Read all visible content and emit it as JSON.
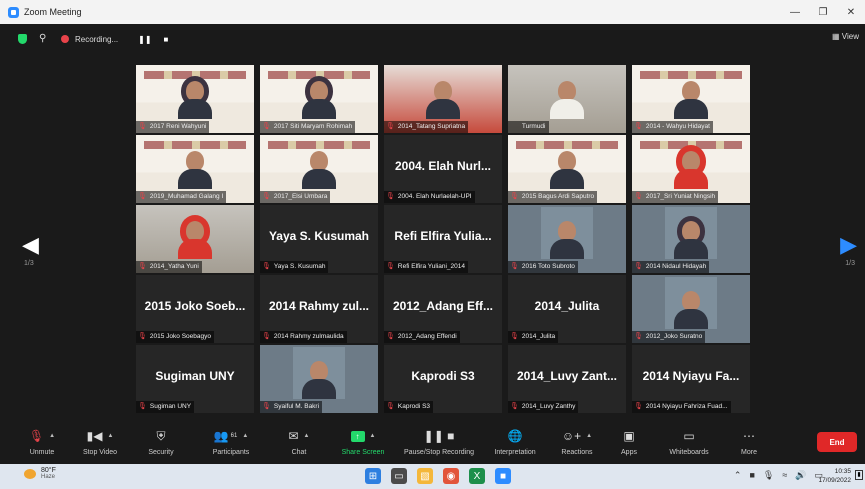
{
  "window": {
    "title": "Zoom Meeting"
  },
  "meeting_bar": {
    "recording_label": "Recording...",
    "view_label": "View"
  },
  "pages": {
    "left": "1/3",
    "right": "1/3"
  },
  "tiles": [
    {
      "name": "2017 Reni Wahyuni",
      "video": true,
      "bg": "slide",
      "person": "hijab"
    },
    {
      "name": "2017 Siti Maryam Rohimah",
      "video": true,
      "bg": "slide",
      "person": "hijab"
    },
    {
      "name": "2014_Tatang Supriatna",
      "video": true,
      "bg": "red",
      "person": "plain",
      "speaking": true
    },
    {
      "name": "Turmudi",
      "video": true,
      "bg": "room",
      "person": "white",
      "muted": false
    },
    {
      "name": "2014 - Wahyu Hidayat",
      "video": true,
      "bg": "slide",
      "person": "plain"
    },
    {
      "name": "2019_Muhamad Galang I",
      "video": true,
      "bg": "slide",
      "person": "plain"
    },
    {
      "name": "2017_Elsi Umbara",
      "video": true,
      "bg": "slide",
      "person": "plain"
    },
    {
      "name": "2004. Elah Nurlaelah-UPI",
      "video": false,
      "display": "2004. Elah Nurl..."
    },
    {
      "name": "2015 Bagus Ardi Saputro",
      "video": true,
      "bg": "slide",
      "person": "plain"
    },
    {
      "name": "2017_Sri Yuniat Ningsih",
      "video": true,
      "bg": "slide",
      "person": "hijab-red"
    },
    {
      "name": "2014_Yatha Yuni",
      "video": true,
      "bg": "room",
      "person": "hijab-red"
    },
    {
      "name": "Yaya S. Kusumah",
      "video": false,
      "display": "Yaya S. Kusumah"
    },
    {
      "name": "Refi Elfira Yuliani_2014",
      "video": false,
      "display": "Refi Elfira Yulia..."
    },
    {
      "name": "2016 Toto Subroto",
      "video": true,
      "bg": "photo",
      "person": "plain"
    },
    {
      "name": "2014 Nidaul Hidayah",
      "video": true,
      "bg": "photo",
      "person": "hijab"
    },
    {
      "name": "2015 Joko Soebagyo",
      "video": false,
      "display": "2015 Joko Soeb..."
    },
    {
      "name": "2014 Rahmy zulmaulida",
      "video": false,
      "display": "2014 Rahmy zul..."
    },
    {
      "name": "2012_Adang Effendi",
      "video": false,
      "display": "2012_Adang Eff..."
    },
    {
      "name": "2014_Julita",
      "video": false,
      "display": "2014_Julita"
    },
    {
      "name": "2012_Joko Suratno",
      "video": true,
      "bg": "photo",
      "person": "plain"
    },
    {
      "name": "Sugiman UNY",
      "video": false,
      "display": "Sugiman UNY"
    },
    {
      "name": "Syaiful M. Bakri",
      "video": true,
      "bg": "photo",
      "person": "plain"
    },
    {
      "name": "Kaprodi S3",
      "video": false,
      "display": "Kaprodi S3"
    },
    {
      "name": "2014_Luvy Zanthy",
      "video": false,
      "display": "2014_Luvy Zant..."
    },
    {
      "name": "2014 Nyiayu Fahriza Fuad...",
      "video": false,
      "display": "2014 Nyiayu Fa..."
    }
  ],
  "controls": {
    "unmute": "Unmute",
    "stop_video": "Stop Video",
    "security": "Security",
    "participants": "Participants",
    "participants_count": "61",
    "chat": "Chat",
    "share_screen": "Share Screen",
    "pause_recording": "Pause/Stop Recording",
    "interpretation": "Interpretation",
    "reactions": "Reactions",
    "apps": "Apps",
    "whiteboards": "Whiteboards",
    "more": "More",
    "end": "End"
  },
  "taskbar": {
    "temperature": "80°F",
    "weather": "Haze",
    "time": "10:35",
    "date": "17/09/2022"
  },
  "colors": {
    "accent": "#2d8cff",
    "end": "#e02828",
    "share": "#23d96b",
    "speaker": "#f6c32a"
  }
}
